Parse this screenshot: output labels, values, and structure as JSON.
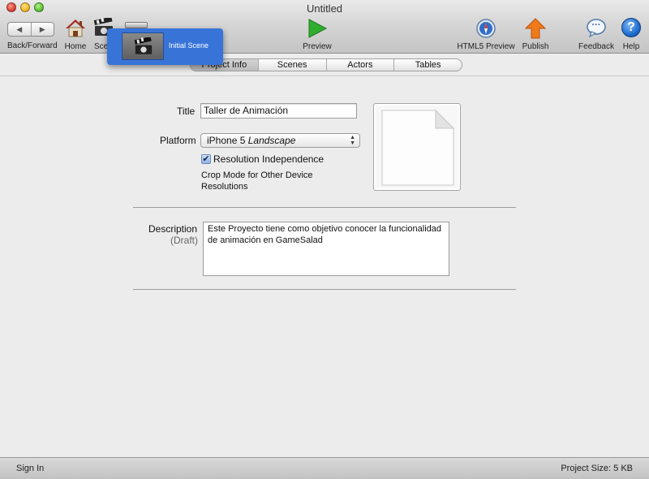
{
  "window": {
    "title": "Untitled"
  },
  "toolbar": {
    "back_forward_label": "Back/Forward",
    "back_glyph": "◀",
    "forward_glyph": "▶",
    "home_label": "Home",
    "scenes_label": "Sce",
    "preview_label": "Preview",
    "html5_preview_label": "HTML5 Preview",
    "publish_label": "Publish",
    "feedback_label": "Feedback",
    "feedback_glyph": "···",
    "help_label": "Help",
    "help_glyph": "?"
  },
  "scene_popup": {
    "item_label": "Initial Scene"
  },
  "tabs": [
    {
      "label": "Project Info",
      "active": true
    },
    {
      "label": "Scenes",
      "active": false
    },
    {
      "label": "Actors",
      "active": false
    },
    {
      "label": "Tables",
      "active": false
    }
  ],
  "project_info": {
    "title_label": "Title",
    "title_value": "Taller de Animación",
    "platform_label": "Platform",
    "platform_device": "iPhone 5",
    "platform_orientation": "Landscape",
    "resolution_independence_label": "Resolution Independence",
    "resolution_independence_checked": true,
    "crop_mode_text": "Crop Mode for Other Device Resolutions",
    "description_label": "Description",
    "description_sublabel": "(Draft)",
    "description_value": "Este Proyecto tiene como objetivo conocer la funcionalidad de animación en GameSalad"
  },
  "status_bar": {
    "sign_in_label": "Sign In",
    "project_size": "Project Size: 5 KB"
  },
  "colors": {
    "accent_blue": "#3874d8",
    "preview_green": "#2fae2f",
    "publish_orange": "#f07a1a",
    "help_blue": "#1f6fd0"
  }
}
